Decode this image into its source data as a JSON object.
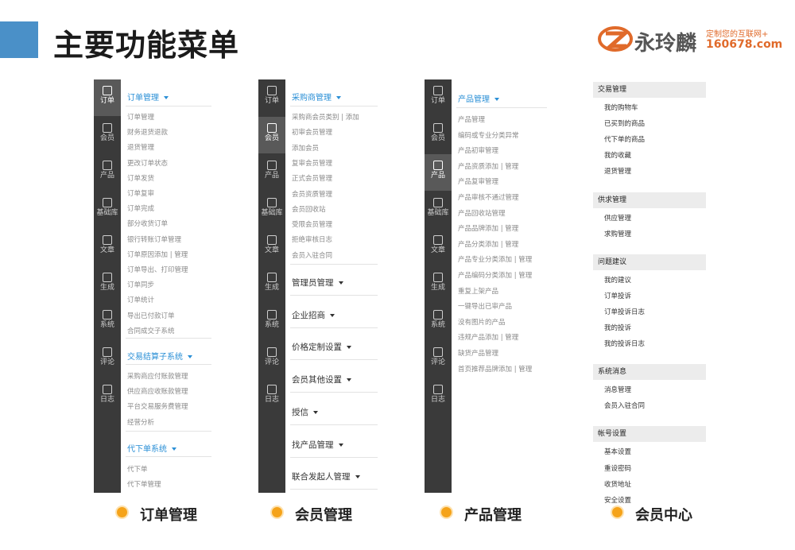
{
  "page": {
    "title": "主要功能菜单"
  },
  "logo": {
    "name": "永玲麟",
    "slogan": "定制您的互联网+",
    "url": "160678.com"
  },
  "sidebar": {
    "items": [
      {
        "label": "订单",
        "icon": "clipboard-icon"
      },
      {
        "label": "会员",
        "icon": "user-icon"
      },
      {
        "label": "产品",
        "icon": "product-icon"
      },
      {
        "label": "基础库",
        "icon": "building-icon"
      },
      {
        "label": "文章",
        "icon": "document-icon"
      },
      {
        "label": "生成",
        "icon": "generate-icon"
      },
      {
        "label": "系统",
        "icon": "gear-icon"
      },
      {
        "label": "评论",
        "icon": "comment-icon"
      },
      {
        "label": "日志",
        "icon": "log-icon"
      }
    ]
  },
  "panels": {
    "order": {
      "caption": "订单管理",
      "sections": [
        {
          "title": "订单管理",
          "items": [
            "订单管理",
            "财务退货退款",
            "退货管理",
            "更改订单状态",
            "订单发货",
            "订单复审",
            "订单完成",
            "部分收货订单",
            "银行转账订单管理",
            "订单原因添加 | 管理",
            "订单导出、打印管理",
            "订单同步",
            "订单统计",
            "导出已付款订单",
            "合同成交子系统"
          ]
        },
        {
          "title": "交易结算子系统",
          "items": [
            "采购商应付账款管理",
            "供应商应收账款管理",
            "平台交易服务费管理",
            "经营分析"
          ]
        },
        {
          "title": "代下单系统",
          "items": [
            "代下单",
            "代下单管理"
          ]
        }
      ]
    },
    "member": {
      "caption": "会员管理",
      "sections": [
        {
          "title": "采购商管理",
          "items": [
            "采购商会员类别 | 添加",
            "初审会员管理",
            "添加会员",
            "复审会员管理",
            "正式会员管理",
            "会员资质管理",
            "会员回收站",
            "受限会员管理",
            "拒绝审核日志",
            "会员入驻合同"
          ]
        }
      ],
      "collapsed": [
        "管理员管理",
        "企业招商",
        "价格定制设置",
        "会员其他设置",
        "授信",
        "找产品管理",
        "联合发起人管理"
      ]
    },
    "product": {
      "caption": "产品管理",
      "sections": [
        {
          "title": "产品管理",
          "items": [
            "产品管理",
            "编码或专业分类异常",
            "产品初审管理",
            "产品资质添加 | 管理",
            "产品复审管理",
            "产品审核不通过管理",
            "产品回收站管理",
            "产品品牌添加 | 管理",
            "产品分类添加 | 管理",
            "产品专业分类添加 | 管理",
            "产品编码分类添加 | 管理",
            "重复上架产品",
            "一键导出已审产品",
            "没有图片的产品",
            "违规产品添加 | 管理",
            "缺货产品管理",
            "首页推荐品牌添加 | 管理"
          ]
        }
      ]
    },
    "center": {
      "caption": "会员中心",
      "groups": [
        {
          "title": "交易管理",
          "items": [
            "我的购物车",
            "已买到的商品",
            "代下单的商品",
            "我的收藏",
            "退货管理"
          ]
        },
        {
          "title": "供求管理",
          "items": [
            "供应管理",
            "求购管理"
          ]
        },
        {
          "title": "问题建议",
          "items": [
            "我的建议",
            "订单投诉",
            "订单投诉日志",
            "我的投诉",
            "我的投诉日志"
          ]
        },
        {
          "title": "系统消息",
          "items": [
            "消息管理",
            "会员入驻合同"
          ]
        },
        {
          "title": "帐号设置",
          "items": [
            "基本设置",
            "重设密码",
            "收货地址",
            "安全设置"
          ]
        }
      ]
    }
  },
  "colors": {
    "accent": "#2a8fd6",
    "sidebar": "#3a3a3a",
    "sidebar_active": "#595959",
    "caption_dot": "#f5a31a",
    "title_bar": "#4a90c8"
  }
}
